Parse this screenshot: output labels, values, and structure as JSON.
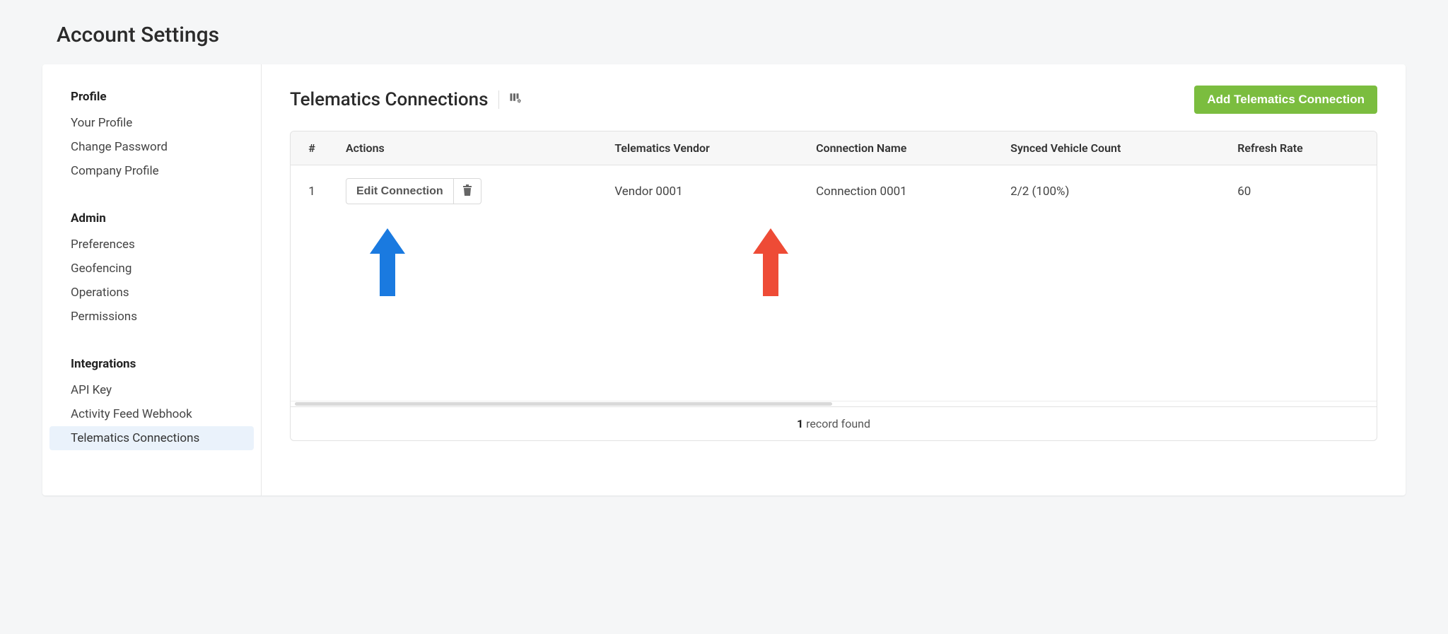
{
  "page_title": "Account Settings",
  "sidebar": {
    "groups": [
      {
        "heading": "Profile",
        "items": [
          {
            "label": "Your Profile",
            "active": false
          },
          {
            "label": "Change Password",
            "active": false
          },
          {
            "label": "Company Profile",
            "active": false
          }
        ]
      },
      {
        "heading": "Admin",
        "items": [
          {
            "label": "Preferences",
            "active": false
          },
          {
            "label": "Geofencing",
            "active": false
          },
          {
            "label": "Operations",
            "active": false
          },
          {
            "label": "Permissions",
            "active": false
          }
        ]
      },
      {
        "heading": "Integrations",
        "items": [
          {
            "label": "API Key",
            "active": false
          },
          {
            "label": "Activity Feed Webhook",
            "active": false
          },
          {
            "label": "Telematics Connections",
            "active": true
          }
        ]
      }
    ]
  },
  "main": {
    "title": "Telematics Connections",
    "add_button": "Add Telematics Connection",
    "columns": {
      "num": "#",
      "actions": "Actions",
      "vendor": "Telematics Vendor",
      "name": "Connection Name",
      "synced": "Synced Vehicle Count",
      "refresh": "Refresh Rate"
    },
    "rows": [
      {
        "num": "1",
        "edit_label": "Edit Connection",
        "vendor": "Vendor 0001",
        "name": "Connection 0001",
        "synced": "2/2 (100%)",
        "refresh": "60"
      }
    ],
    "footer_count": "1",
    "footer_text": " record found"
  },
  "annotations": {
    "blue_arrow_color": "#1a7ae0",
    "red_arrow_color": "#ee4b36"
  }
}
